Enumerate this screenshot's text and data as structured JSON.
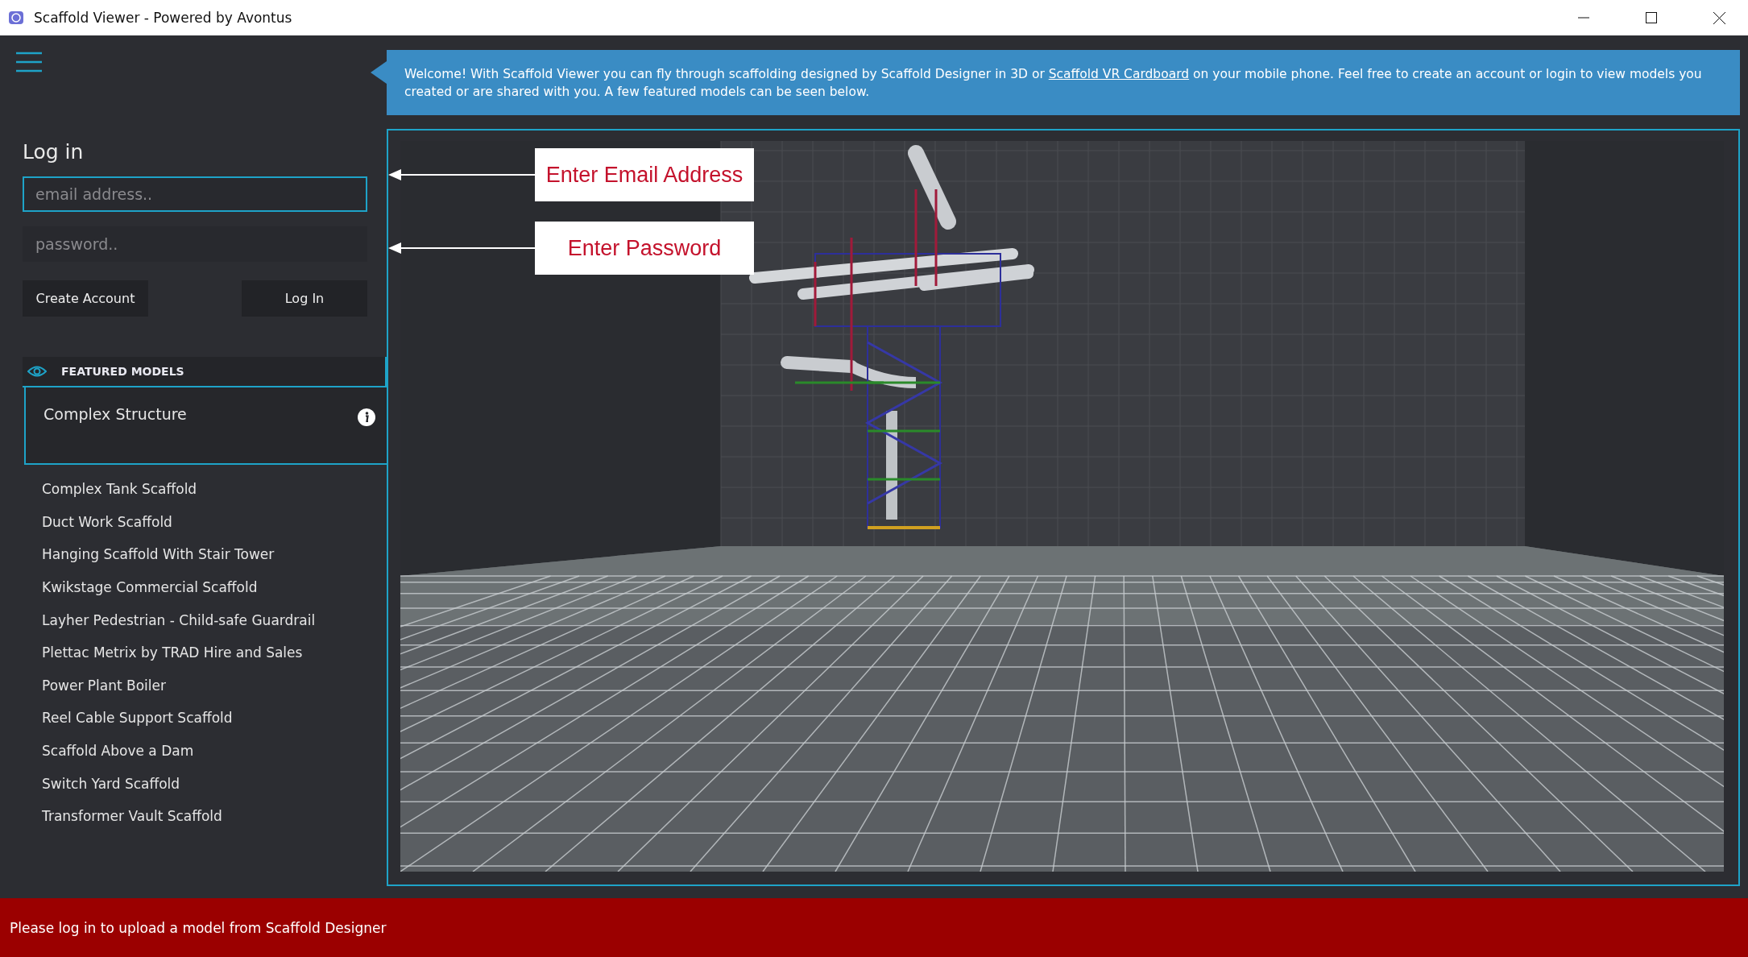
{
  "window": {
    "title": "Scaffold Viewer - Powered by Avontus"
  },
  "login": {
    "heading": "Log in",
    "email": {
      "placeholder": "email address.."
    },
    "password": {
      "placeholder": "password.."
    },
    "buttons": [
      "Create Account",
      "Log In"
    ]
  },
  "featured": {
    "heading": "FEATURED MODELS",
    "models": [
      {
        "name": "Complex Structure",
        "selected": true
      },
      {
        "name": "Complex Tank Scaffold",
        "selected": false
      },
      {
        "name": "Duct Work Scaffold",
        "selected": false
      },
      {
        "name": "Hanging Scaffold With Stair Tower",
        "selected": false
      },
      {
        "name": "Kwikstage Commercial Scaffold",
        "selected": false
      },
      {
        "name": "Layher Pedestrian - Child-safe Guardrail",
        "selected": false
      },
      {
        "name": "Plettac Metrix by TRAD Hire and Sales",
        "selected": false
      },
      {
        "name": "Power Plant Boiler",
        "selected": false
      },
      {
        "name": "Reel Cable Support Scaffold",
        "selected": false
      },
      {
        "name": "Scaffold Above a Dam",
        "selected": false
      },
      {
        "name": "Switch Yard Scaffold",
        "selected": false
      },
      {
        "name": "Transformer Vault Scaffold",
        "selected": false
      }
    ]
  },
  "banner": {
    "before": "Welcome! With Scaffold Viewer you can fly through scaffolding designed by Scaffold Designer in 3D or ",
    "link": "Scaffold VR Cardboard",
    "after": " on your mobile phone. Feel free to create an account or login to view models you created or are shared with you. A few featured models can be seen below."
  },
  "callouts": [
    "Enter Email Address",
    "Enter Password"
  ],
  "status_bar": "Please log in to upload a model from Scaffold Designer"
}
